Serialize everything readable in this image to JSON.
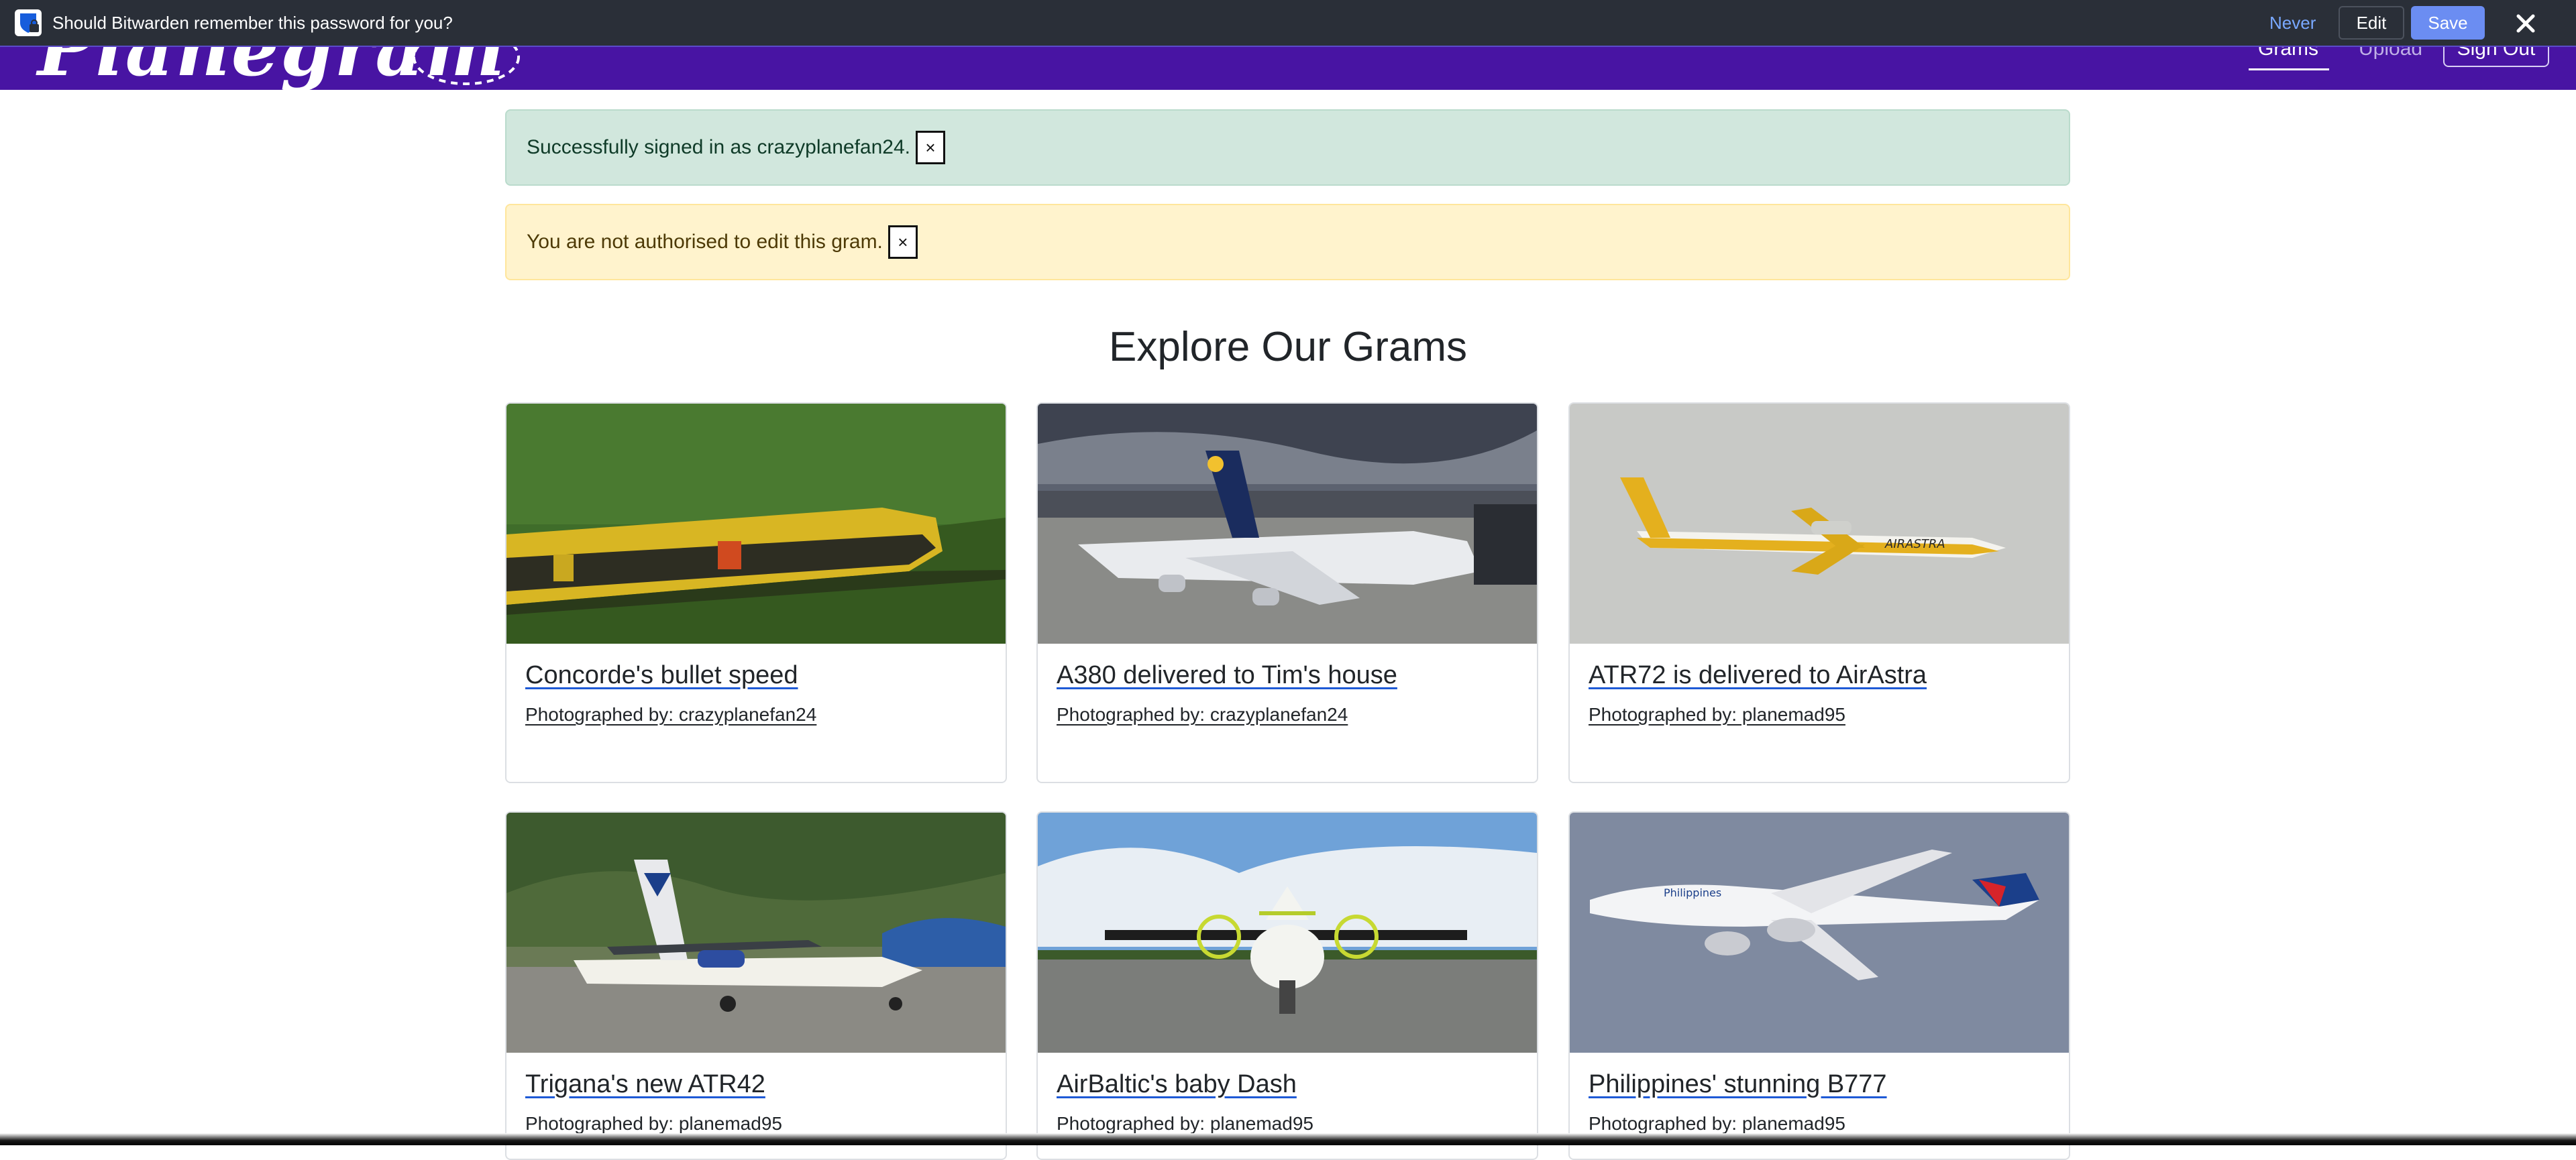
{
  "bitwarden": {
    "prompt": "Should Bitwarden remember this password for you?",
    "never_label": "Never",
    "edit_label": "Edit",
    "save_label": "Save",
    "accent_color": "#6b8df2"
  },
  "navbar": {
    "brand": "Planegram",
    "links": [
      {
        "label": "Grams",
        "active": true
      },
      {
        "label": "Upload",
        "active": false
      }
    ],
    "signout_label": "Sign Out",
    "background": "#4814a3"
  },
  "alerts": [
    {
      "type": "success",
      "message": "Successfully signed in as crazyplanefan24.",
      "close": "×"
    },
    {
      "type": "warning",
      "message": "You are not authorised to edit this gram.",
      "close": "×"
    }
  ],
  "page": {
    "heading": "Explore Our Grams"
  },
  "grams": [
    {
      "title": "Concorde's bullet speed",
      "byline": "Photographed by: crazyplanefan24",
      "image": "yellow-train-photo"
    },
    {
      "title": "A380 delivered to Tim's house",
      "byline": "Photographed by: crazyplanefan24",
      "image": "lufthansa-a380-photo"
    },
    {
      "title": "ATR72 is delivered to AirAstra",
      "byline": "Photographed by: planemad95",
      "image": "airastra-atr72-photo"
    },
    {
      "title": "Trigana's new ATR42",
      "byline": "Photographed by: planemad95",
      "image": "trigana-atr42-photo"
    },
    {
      "title": "AirBaltic's baby Dash",
      "byline": "Photographed by: planemad95",
      "image": "airbaltic-dash-photo"
    },
    {
      "title": "Philippines' stunning B777",
      "byline": "Photographed by: planemad95",
      "image": "philippines-b777-photo"
    }
  ]
}
